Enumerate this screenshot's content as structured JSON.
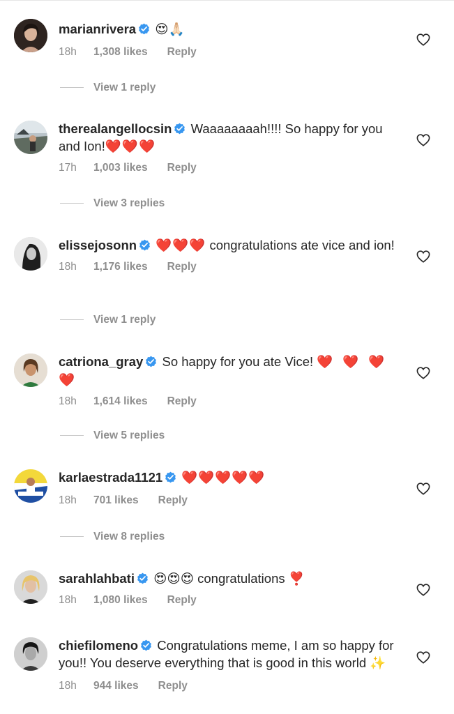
{
  "comments": [
    {
      "username": "marianrivera",
      "text_emoji": "😍🙏🏻",
      "text": "",
      "time": "18h",
      "likes": "1,308 likes",
      "reply_label": "Reply",
      "view_replies": "View 1 reply",
      "avatar_icon": "avatar-photo"
    },
    {
      "username": "therealangellocsin",
      "text": "Waaaaaaaah!!!! So happy for you and Ion!",
      "text_emoji": "❤️❤️❤️",
      "time": "17h",
      "likes": "1,003 likes",
      "reply_label": "Reply",
      "view_replies": "View 3 replies"
    },
    {
      "username": "elissejosonn",
      "text_emoji": "❤️❤️❤️",
      "text": "congratulations ate vice and ion!",
      "time": "18h",
      "likes": "1,176 likes",
      "reply_label": "Reply",
      "view_replies": "View 1 reply"
    },
    {
      "username": "catriona_gray",
      "text": "So happy for you ate Vice!",
      "text_emoji": "❤️❤️❤️❤️",
      "time": "18h",
      "likes": "1,614 likes",
      "reply_label": "Reply",
      "view_replies": "View 5 replies"
    },
    {
      "username": "karlaestrada1121",
      "text_emoji": "❤️❤️❤️❤️❤️",
      "text": "",
      "time": "18h",
      "likes": "701 likes",
      "reply_label": "Reply",
      "view_replies": "View 8 replies"
    },
    {
      "username": "sarahlahbati",
      "text_emoji": "😍😍😍",
      "text": "congratulations",
      "text_emoji_after": "❣️",
      "time": "18h",
      "likes": "1,080 likes",
      "reply_label": "Reply"
    },
    {
      "username": "chiefilomeno",
      "text": "Congratulations meme, I am so happy for you!! You deserve everything that is good in this world",
      "text_emoji_after": "✨",
      "time": "18h",
      "likes": "944 likes",
      "reply_label": "Reply"
    }
  ],
  "icons": {
    "verified": "verified-badge-icon",
    "like": "heart-outline-icon"
  },
  "colors": {
    "verified_blue": "#3897f0",
    "meta_gray": "#8e8e8e",
    "heart_red": "#e0242b"
  }
}
